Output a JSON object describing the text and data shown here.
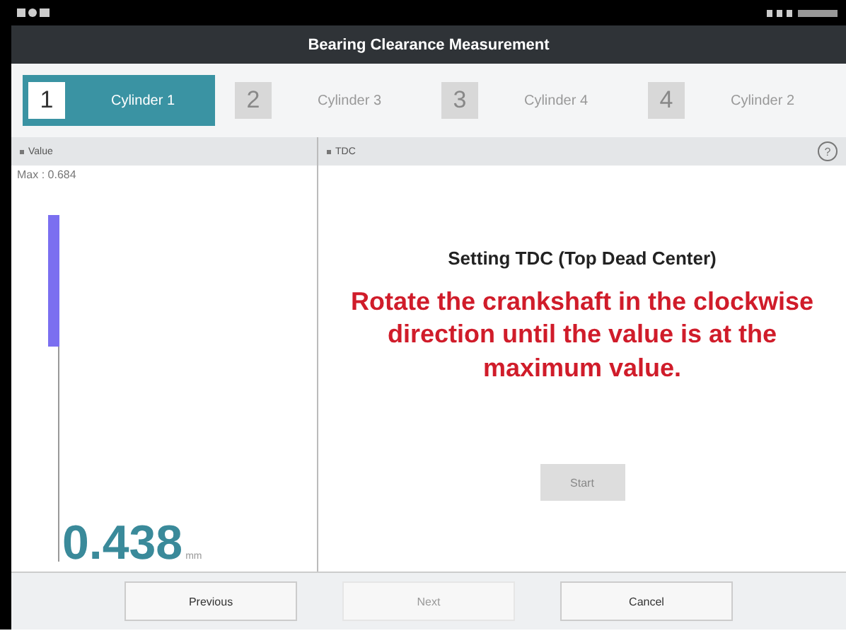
{
  "window": {
    "title": "Bearing Clearance Measurement"
  },
  "steps": [
    {
      "number": "1",
      "label": "Cylinder 1",
      "selected": true
    },
    {
      "number": "2",
      "label": "Cylinder 3",
      "selected": false
    },
    {
      "number": "3",
      "label": "Cylinder 4",
      "selected": false
    },
    {
      "number": "4",
      "label": "Cylinder 2",
      "selected": false
    }
  ],
  "value_panel": {
    "header": "Value",
    "max": "Max : 0.684",
    "gauge": {
      "level": 0.38
    },
    "reading": "0.438",
    "unit": "mm"
  },
  "tdc_panel": {
    "header": "TDC",
    "help": "?",
    "title": "Setting TDC (Top Dead Center)",
    "instruction": "Rotate the crankshaft in the clockwise direction until the value is at the maximum value.",
    "start": {
      "label": "Start",
      "disabled": true
    }
  },
  "buttons": [
    {
      "label": "Previous",
      "disabled": false
    },
    {
      "label": "Next",
      "disabled": true
    },
    {
      "label": "Cancel",
      "disabled": false
    }
  ]
}
